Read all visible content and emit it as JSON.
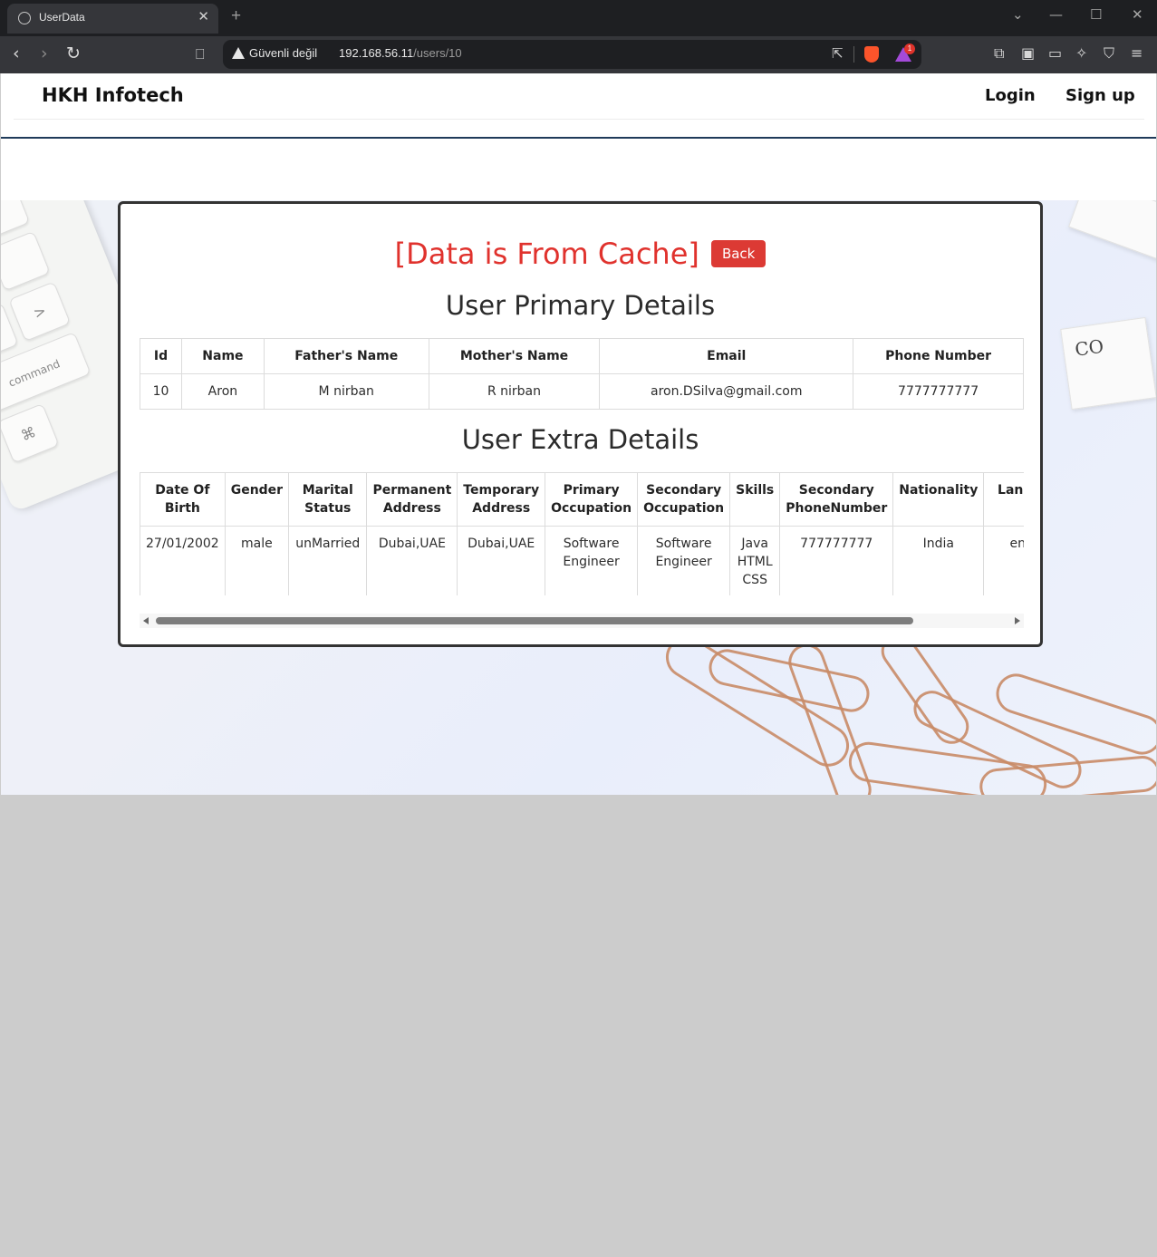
{
  "browser": {
    "tab_title": "UserData",
    "security_label": "Güvenli değil",
    "url_host": "192.168.56.11",
    "url_path": "/users/10",
    "badge_count": "1"
  },
  "navbar": {
    "brand": "HKH Infotech",
    "login": "Login",
    "signup": "Sign up"
  },
  "main": {
    "cache_title": "[Data is From Cache]",
    "back_label": "Back",
    "primary_title": "User Primary Details",
    "extra_title": "User Extra Details"
  },
  "primary_table": {
    "headers": [
      "Id",
      "Name",
      "Father's Name",
      "Mother's Name",
      "Email",
      "Phone Number"
    ],
    "row": [
      "10",
      "Aron",
      "M nirban",
      "R nirban",
      "aron.DSilva@gmail.com",
      "7777777777"
    ]
  },
  "extra_table": {
    "headers": [
      "Date Of Birth",
      "Gender",
      "Marital Status",
      "Permanent Address",
      "Temporary Address",
      "Primary Occupation",
      "Secondary Occupation",
      "Skills",
      "Secondary PhoneNumber",
      "Nationality",
      "Language"
    ],
    "row": [
      "27/01/2002",
      "male",
      "unMarried",
      "Dubai,UAE",
      "Dubai,UAE",
      "Software Engineer",
      "Software Engineer",
      "Java HTML CSS",
      "777777777",
      "India",
      "english"
    ]
  },
  "decor": {
    "keyboard_keys": [
      "⌘",
      "command",
      "<",
      ">",
      "L"
    ],
    "card_text": "CO"
  },
  "colors": {
    "accent_red": "#e0322d",
    "button_red": "#dc3a34",
    "nav_border": "#1f3b5a"
  }
}
